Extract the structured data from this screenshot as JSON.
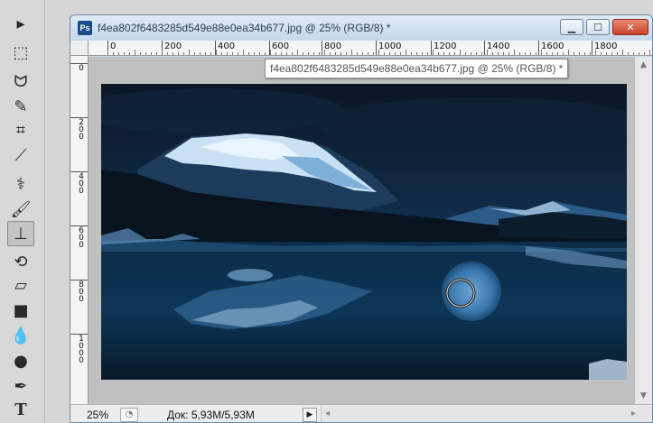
{
  "toolbox": {
    "tools": [
      {
        "name": "move-tool",
        "glyph": "▸",
        "active": false
      },
      {
        "name": "marquee-tool",
        "glyph": "⬚",
        "active": false
      },
      {
        "name": "lasso-tool",
        "glyph": "ᗢ",
        "active": false
      },
      {
        "name": "quick-selection-tool",
        "glyph": "✎",
        "active": false
      },
      {
        "name": "crop-tool",
        "glyph": "⌗",
        "active": false
      },
      {
        "name": "eyedropper-tool",
        "glyph": "⟋",
        "active": false
      },
      {
        "name": "healing-brush-tool",
        "glyph": "⚕",
        "active": false
      },
      {
        "name": "brush-tool",
        "glyph": "🖌",
        "active": false
      },
      {
        "name": "clone-stamp-tool",
        "glyph": "⊥",
        "active": true
      },
      {
        "name": "history-brush-tool",
        "glyph": "⟲",
        "active": false
      },
      {
        "name": "eraser-tool",
        "glyph": "▱",
        "active": false
      },
      {
        "name": "gradient-tool",
        "glyph": "■",
        "active": false
      },
      {
        "name": "blur-tool",
        "glyph": "💧",
        "active": false
      },
      {
        "name": "dodge-tool",
        "glyph": "●",
        "active": false
      },
      {
        "name": "pen-tool",
        "glyph": "✒",
        "active": false
      },
      {
        "name": "type-tool",
        "glyph": "T",
        "active": false
      }
    ]
  },
  "document": {
    "app_badge": "Ps",
    "title": "f4ea802f6483285d549e88e0ea34b677.jpg @ 25% (RGB/8) *",
    "tooltip": "f4ea802f6483285d549e88e0ea34b677.jpg @ 25% (RGB/8) *",
    "buttons": {
      "minimize": "▁",
      "maximize": "☐",
      "close": "✕"
    }
  },
  "rulers": {
    "horizontal_labels": [
      "0",
      "200",
      "400",
      "600",
      "800",
      "1000",
      "1200",
      "1400",
      "1600",
      "1800"
    ],
    "vertical_labels": [
      "0",
      "200",
      "400",
      "600",
      "800",
      "1000"
    ]
  },
  "status": {
    "zoom": "25%",
    "doc_info": "Док: 5,93M/5,93M",
    "nav_arrow": "▶",
    "scroll_left": "◂",
    "scroll_right": "▸"
  },
  "colors": {
    "accent": "#1a4e88",
    "window_frame": "#c9dcef",
    "close_button": "#c9432b"
  }
}
